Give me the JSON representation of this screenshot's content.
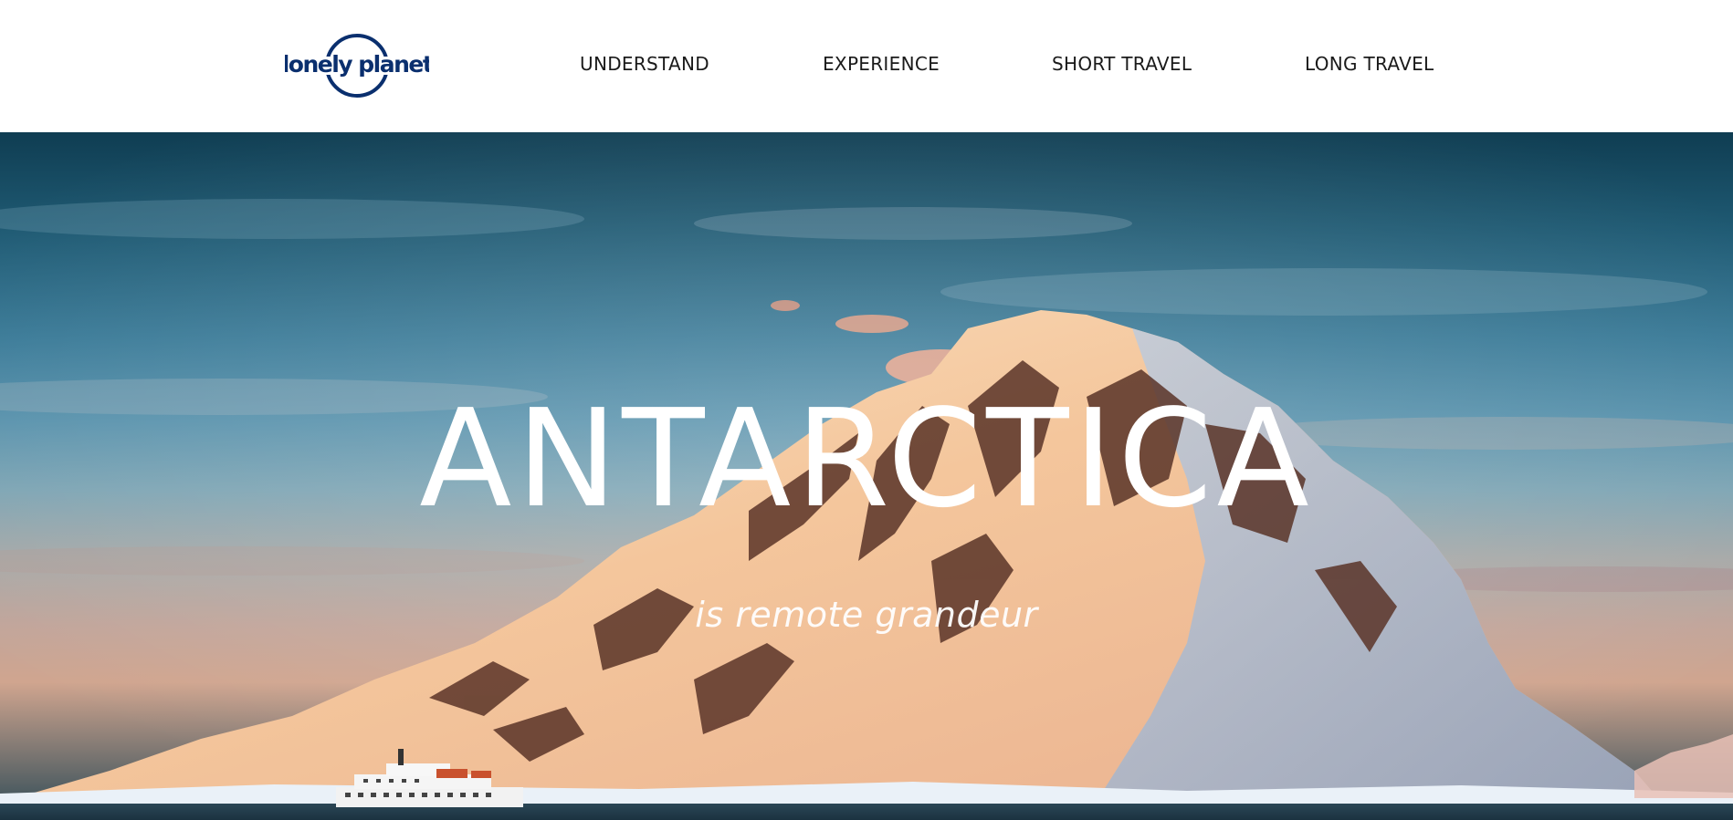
{
  "header": {
    "logo_text": "lonely planet",
    "brand_color": "#0a2f6e",
    "nav": [
      {
        "label": "UNDERSTAND"
      },
      {
        "label": "EXPERIENCE"
      },
      {
        "label": "SHORT TRAVEL"
      },
      {
        "label": "LONG TRAVEL"
      }
    ]
  },
  "hero": {
    "title": "ANTARCTICA",
    "subtitle": "is remote grandeur"
  }
}
